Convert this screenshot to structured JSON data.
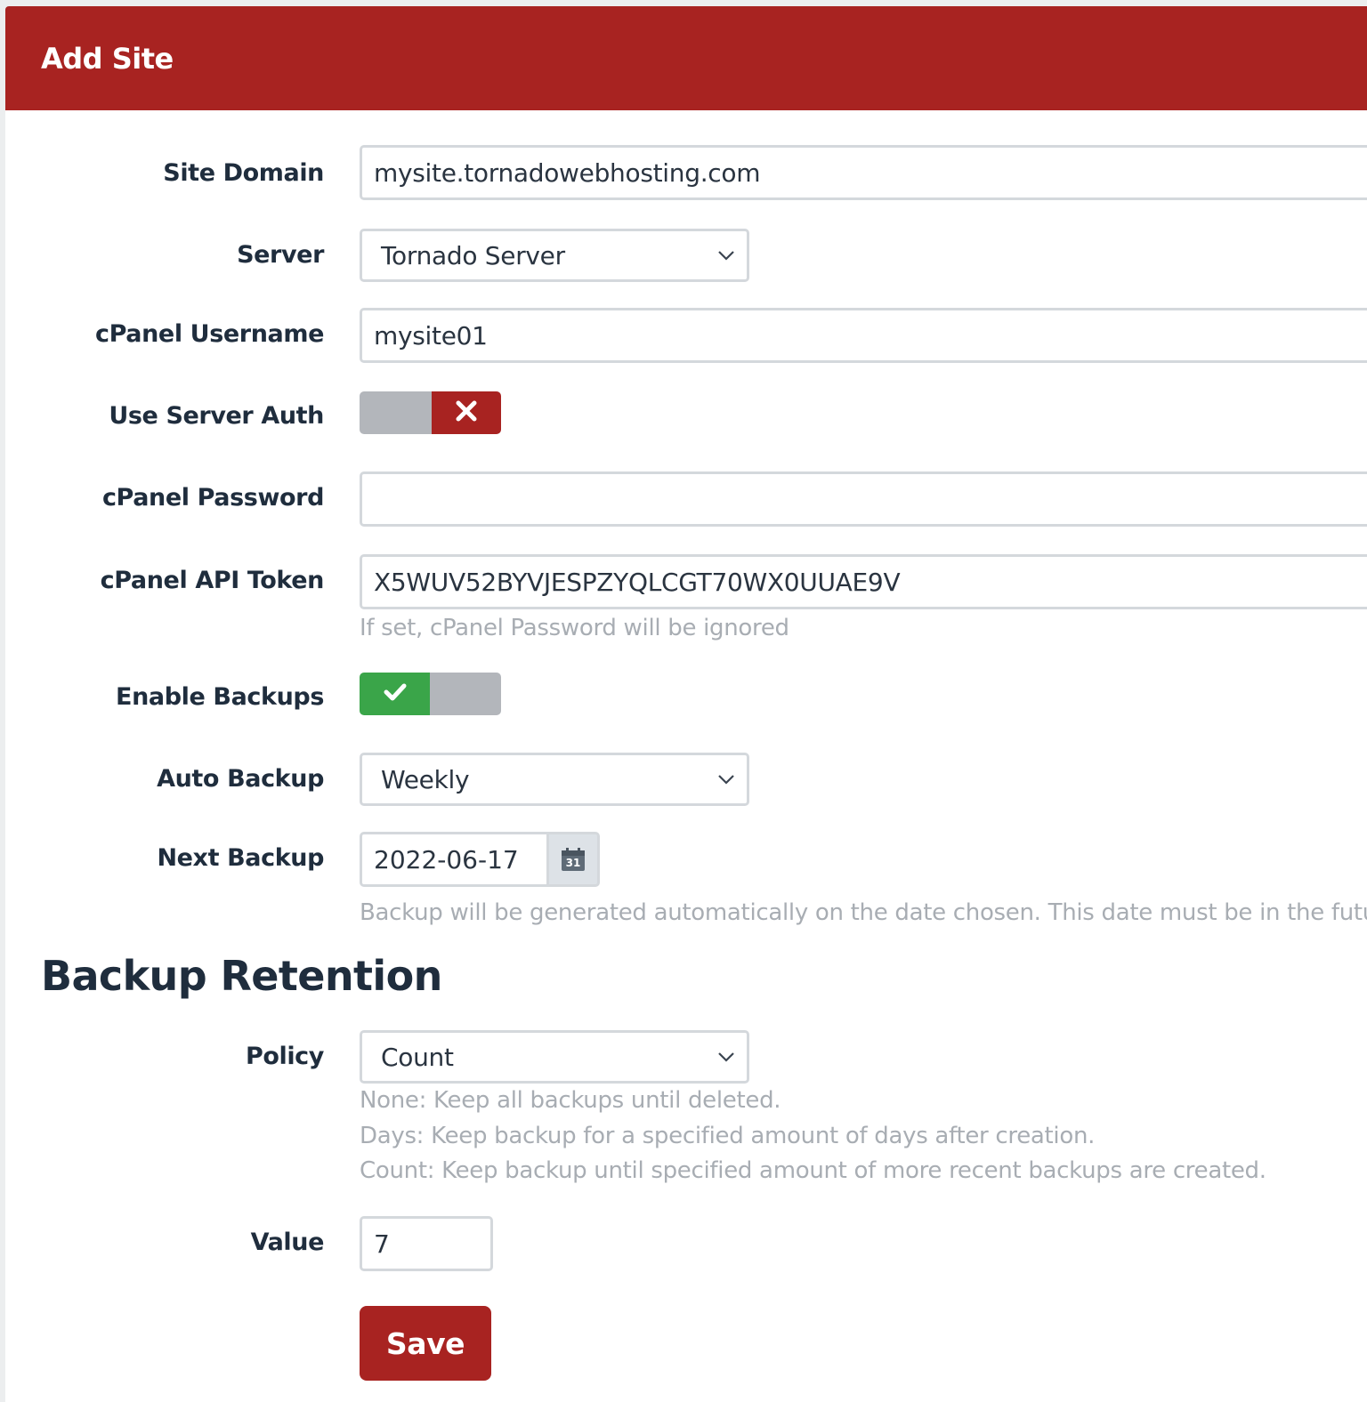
{
  "header": {
    "title": "Add Site"
  },
  "form": {
    "site_domain": {
      "label": "Site Domain",
      "value": "mysite.tornadowebhosting.com"
    },
    "server": {
      "label": "Server",
      "selected": "Tornado Server"
    },
    "cpanel_username": {
      "label": "cPanel Username",
      "value": "mysite01"
    },
    "use_server_auth": {
      "label": "Use Server Auth",
      "state": "off",
      "icon": "x-icon"
    },
    "cpanel_password": {
      "label": "cPanel Password",
      "value": ""
    },
    "cpanel_api_token": {
      "label": "cPanel API Token",
      "value": "X5WUV52BYVJESPZYQLCGT70WX0UUAE9V",
      "help": "If set, cPanel Password will be ignored"
    },
    "enable_backups": {
      "label": "Enable Backups",
      "state": "on",
      "icon": "check-icon"
    },
    "auto_backup": {
      "label": "Auto Backup",
      "selected": "Weekly"
    },
    "next_backup": {
      "label": "Next Backup",
      "value": "2022-06-17",
      "calendar_day": "31",
      "help": "Backup will be generated automatically on the date chosen. This date must be in the future."
    }
  },
  "retention": {
    "title": "Backup Retention",
    "policy": {
      "label": "Policy",
      "selected": "Count",
      "help": [
        "None: Keep all backups until deleted.",
        "Days: Keep backup for a specified amount of days after creation.",
        "Count: Keep backup until specified amount of more recent backups are created."
      ]
    },
    "value": {
      "label": "Value",
      "value": "7"
    }
  },
  "actions": {
    "save_label": "Save"
  },
  "colors": {
    "brand": "#a82321",
    "success": "#3aa549",
    "toggle_off": "#b3b6bb",
    "help_text": "#a8adb3",
    "border": "#d4d8dc"
  }
}
